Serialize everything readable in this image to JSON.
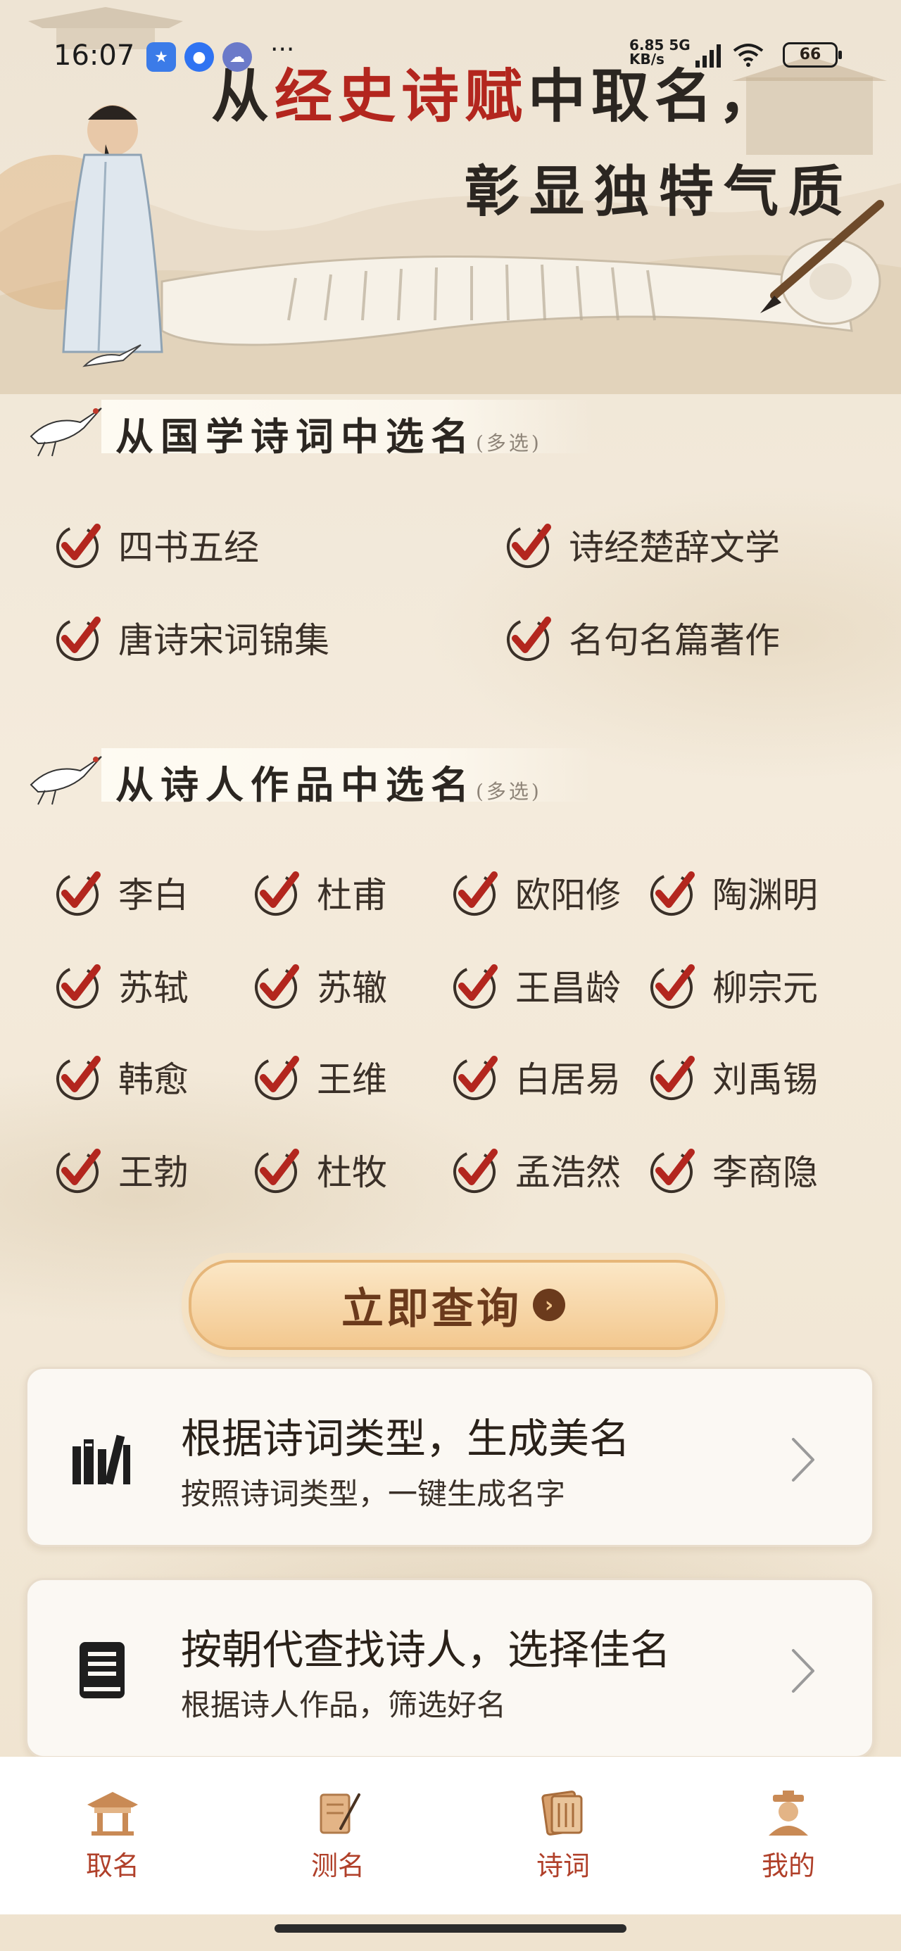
{
  "status_bar": {
    "time": "16:07",
    "net_speed": "6.85",
    "net_unit": "KB/s",
    "net_type": "5G",
    "battery": "66"
  },
  "hero": {
    "headline_part1": "从",
    "headline_red": "经史诗赋",
    "headline_part2": "中取名，",
    "headline_line2": "彰显独特气质"
  },
  "section_classics": {
    "title": "从国学诗词中选名",
    "hint": "(多选)",
    "options": [
      "四书五经",
      "诗经楚辞文学",
      "唐诗宋词锦集",
      "名句名篇著作"
    ]
  },
  "section_poets": {
    "title": "从诗人作品中选名",
    "hint": "(多选)",
    "options": [
      "李白",
      "杜甫",
      "欧阳修",
      "陶渊明",
      "苏轼",
      "苏辙",
      "王昌龄",
      "柳宗元",
      "韩愈",
      "王维",
      "白居易",
      "刘禹锡",
      "王勃",
      "杜牧",
      "孟浩然",
      "李商隐"
    ]
  },
  "query_button": {
    "label": "立即查询",
    "icon": "chevron-right-icon"
  },
  "cards": [
    {
      "title": "根据诗词类型，生成美名",
      "subtitle": "按照诗词类型，一键生成名字",
      "icon": "books-icon"
    },
    {
      "title": "按朝代查找诗人，选择佳名",
      "subtitle": "根据诗人作品，筛选好名",
      "icon": "book-icon"
    }
  ],
  "bottom_nav": {
    "items": [
      {
        "label": "取名",
        "icon": "pavilion-icon"
      },
      {
        "label": "测名",
        "icon": "scroll-brush-icon"
      },
      {
        "label": "诗词",
        "icon": "poetry-book-icon",
        "active": true
      },
      {
        "label": "我的",
        "icon": "scholar-avatar-icon"
      }
    ]
  },
  "colors": {
    "accent": "#b0402a",
    "check_red": "#b3261e",
    "button_brown": "#6b3a1c"
  }
}
